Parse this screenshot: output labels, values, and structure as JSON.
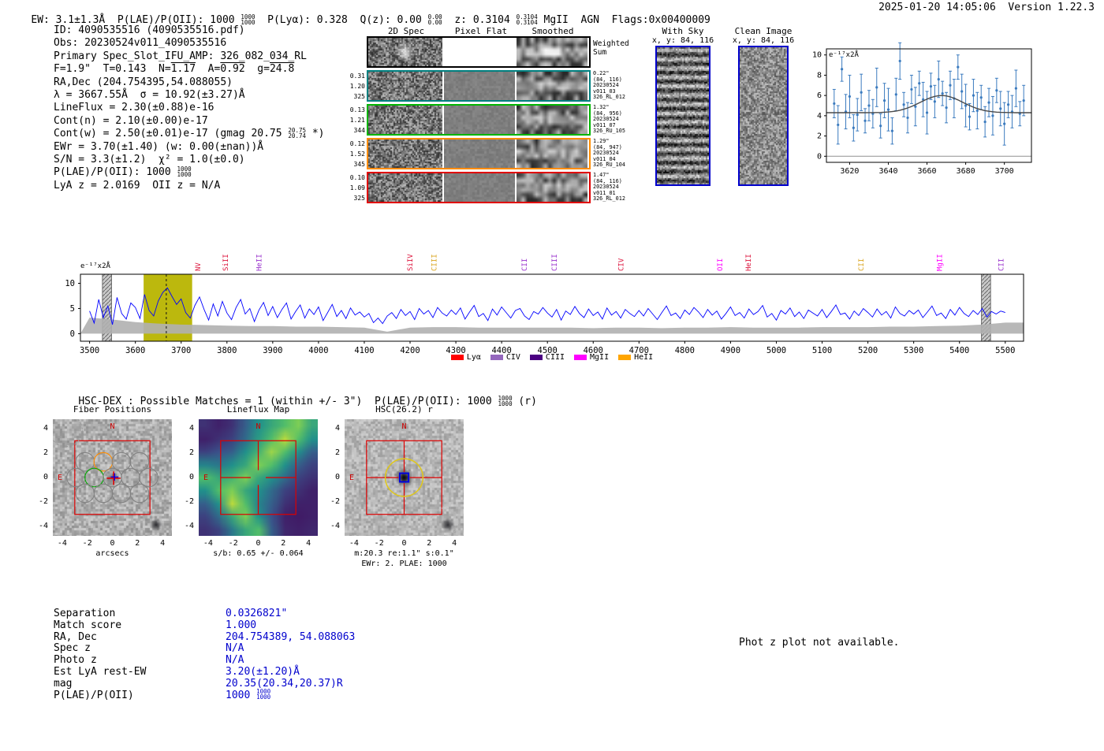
{
  "header": {
    "p1": "EW: 3.1±1.3Å  P(LAE)/P(OII): 1000 ",
    "f1": {
      "top": "1000",
      "bottom": "1000"
    },
    "p2": "  P(Lyα): 0.328  Q(z): 0.00 ",
    "f2": {
      "top": "0.00",
      "bottom": "0.00"
    },
    "p3": "  z: 0.3104 ",
    "f3": {
      "top": "0.3104",
      "bottom": "0.3104"
    },
    "p4": " MgII  AGN  Flags:0x00400009"
  },
  "meta": {
    "text": "2025-01-20 14:05:06  Version 1.22.3"
  },
  "info": {
    "id": "ID: 4090535516 (4090535516.pdf)",
    "obs": "Obs: 20230524v011_4090535516",
    "slot": "Primary Spec_Slot_IFU_AMP: 326_082_034_RL",
    "seeing_pre": "F=1.9\"  T=0.143  N=",
    "seeing_n": "1.17",
    "seeing_mid1": "  A=",
    "seeing_a": "0.92",
    "seeing_mid2": "  g=",
    "seeing_g": "24.8",
    "radec": "RA,Dec (204.754395,54.088055)",
    "lambda": "λ = 3667.55Å  σ = 10.92(±3.27)Å",
    "lineflux": "LineFlux = 2.30(±0.88)e-16",
    "contn": "Cont(n) = 2.10(±0.00)e-17",
    "contw_pre": "Cont(w) = 2.50(±0.01)e-17 (gmag 20.75 ",
    "contw_frac": {
      "top": "20.75",
      "bottom": "20.74"
    },
    "contw_post": " *)",
    "ewr": "EWr = 3.70(±1.40) (w: 0.00(±nan))Å",
    "sn": "S/N = 3.3(±1.2)  χ² = 1.0(±0.0)",
    "plae_pre": "P(LAE)/P(OII): 1000 ",
    "plae_frac": {
      "top": "1000",
      "bottom": "1000"
    },
    "lyaz": "LyA z = 2.0169  OII z = N/A"
  },
  "spec2d": {
    "headers": [
      "2D Spec",
      "Pixel Flat",
      "Smoothed"
    ],
    "withsky": {
      "title": "With Sky",
      "coords": "x, y: 84, 116"
    },
    "clean": {
      "title": "Clean Image",
      "coords": "x, y: 84, 116"
    },
    "rows": [
      {
        "frame": "#000000",
        "weighted": true,
        "left": [],
        "right": [
          "Weighted",
          "Sum"
        ]
      },
      {
        "frame": "#008080",
        "weighted": false,
        "left": [
          "0.31",
          "1.20",
          "325"
        ],
        "right": [
          "0.22\"",
          "(84, 116)",
          "20230524",
          "v011_03",
          "326_RL_012"
        ]
      },
      {
        "frame": "#00b400",
        "weighted": false,
        "left": [
          "0.13",
          "1.21",
          "344"
        ],
        "right": [
          "1.32\"",
          "(84, 956)",
          "20230524",
          "v011_07",
          "326_RU_105"
        ]
      },
      {
        "frame": "#ff8c00",
        "weighted": false,
        "left": [
          "0.12",
          "1.52",
          "345"
        ],
        "right": [
          "1.29\"",
          "(84, 947)",
          "20230524",
          "v011_04",
          "326_RU_104"
        ]
      },
      {
        "frame": "#e00000",
        "weighted": false,
        "left": [
          "0.10",
          "1.09",
          "325"
        ],
        "right": [
          "1.47\"",
          "(84, 116)",
          "20230524",
          "v011_01",
          "326_RL_012"
        ]
      }
    ]
  },
  "hscdex": {
    "p1": "HSC-DEX : Possible Matches = 1 (within +/- 3\")  P(LAE)/P(OII): 1000 ",
    "f1": {
      "top": "1000",
      "bottom": "1000"
    },
    "p2": " (r)"
  },
  "cutouts": {
    "ticks": [
      -4,
      -2,
      0,
      2,
      4
    ],
    "fiber": {
      "title": "Fiber Positions",
      "xlabel": "arcsecs",
      "north_label": "N",
      "east_label": "E",
      "circle_radius": 0.74,
      "circles": [
        [
          -2.18,
          1.28
        ],
        [
          -0.73,
          1.28
        ],
        [
          0.72,
          1.28
        ],
        [
          2.17,
          1.28
        ],
        [
          -2.9,
          0
        ],
        [
          -1.45,
          0
        ],
        [
          0,
          0
        ],
        [
          1.45,
          0
        ],
        [
          2.9,
          0
        ],
        [
          -2.18,
          -1.28
        ],
        [
          -0.73,
          -1.28
        ],
        [
          0.72,
          -1.28
        ],
        [
          2.17,
          -1.28
        ]
      ],
      "green_circle": [
        -1.45,
        0
      ],
      "orange_circle": [
        -0.73,
        1.28
      ],
      "square": [
        -3,
        3
      ],
      "red_cross": [
        0.1,
        -0.05
      ],
      "blue_cross": [
        0.18,
        0.05
      ],
      "dashed_circle": [
        -3.7,
        3.85,
        1.3
      ]
    },
    "lineflux": {
      "title": "Lineflux Map",
      "xlabel": "s/b: 0.65 +/- 0.064",
      "north_label": "N",
      "east_label": "E",
      "square": [
        -3,
        3
      ]
    },
    "hsc": {
      "title": "HSC(26.2) r",
      "xlabel": "m:20.3 re:1.1\" s:0.1\"",
      "xlabel2": "EWr: 2. PLAE: 1000",
      "north_label": "N",
      "east_label": "E",
      "square": [
        -3,
        3
      ],
      "aperture_radius": 1.5,
      "blue_square_size": 0.7,
      "dashed_circles": [
        [
          -3.3,
          4.2,
          1.0
        ],
        [
          3.25,
          -3.6,
          1.1
        ]
      ]
    }
  },
  "match_table": {
    "rows": [
      {
        "label": "Separation",
        "value": "0.0326821\""
      },
      {
        "label": "Match score",
        "value": "1.000"
      },
      {
        "label": "RA, Dec",
        "value": "204.754389, 54.088063"
      },
      {
        "label": "Spec z",
        "value": "N/A"
      },
      {
        "label": "Photo z",
        "value": "N/A"
      },
      {
        "label": "Est LyA rest-EW",
        "value": "3.20(±1.20)Å"
      },
      {
        "label": "mag",
        "value": "20.35(20.34,20.37)R"
      },
      {
        "label": "P(LAE)/P(OII)",
        "value": "1000",
        "frac": {
          "top": "1000",
          "bottom": "1000"
        }
      }
    ]
  },
  "photz_note": "Phot z plot not available.",
  "chart_data": [
    {
      "id": "line_fit_inset",
      "type": "scatter",
      "corner_label": "e⁻¹⁷x2Å",
      "x_start": 3612,
      "x_step": 2,
      "y": [
        5.2,
        3.1,
        8.6,
        4.4,
        5.9,
        2.8,
        4.1,
        6.3,
        3.5,
        5.0,
        4.2,
        6.8,
        3.0,
        5.5,
        4.6,
        2.5,
        6.1,
        9.4,
        5.1,
        3.8,
        6.6,
        4.9,
        7.2,
        5.6,
        4.3,
        6.9,
        5.4,
        7.6,
        6.2,
        4.8,
        7.0,
        5.7,
        8.8,
        6.4,
        5.0,
        3.9,
        6.0,
        4.5,
        5.8,
        3.4,
        5.3,
        4.0,
        6.5,
        4.7,
        3.2,
        5.1,
        4.4,
        6.7,
        4.2,
        5.5
      ],
      "yerr": [
        1.4,
        1.9,
        1.2,
        1.7,
        2.1,
        1.3,
        1.6,
        1.8,
        1.2,
        1.5,
        1.4,
        1.9,
        1.2,
        1.7,
        2.1,
        1.3,
        1.6,
        1.8,
        1.2,
        1.5,
        1.4,
        1.9,
        1.2,
        1.7,
        2.1,
        1.3,
        1.6,
        1.8,
        1.2,
        1.5,
        1.4,
        1.9,
        1.2,
        1.7,
        2.1,
        1.3,
        1.6,
        1.8,
        1.2,
        1.5,
        1.4,
        1.9,
        1.2,
        1.7,
        2.1,
        1.3,
        1.6,
        1.8,
        1.2,
        1.5
      ],
      "fit": {
        "center": 3667.55,
        "sigma": 10.92,
        "continuum": 4.3,
        "amplitude": 1.7
      },
      "xticks": [
        3620,
        3640,
        3660,
        3680,
        3700
      ],
      "yticks": [
        0,
        2,
        4,
        6,
        8,
        10
      ],
      "xlim": [
        3608,
        3714
      ],
      "ylim": [
        -0.6,
        10.6
      ],
      "point_color": "#3b7bbf",
      "fit_color": "#4a4a4a"
    },
    {
      "id": "full_spectrum",
      "type": "line",
      "corner_label": "e⁻¹⁷x2Å",
      "x_start": 3500,
      "x_step": 10,
      "flux": [
        4.5,
        2.1,
        6.8,
        3.2,
        5.5,
        1.8,
        7.2,
        4.0,
        2.9,
        6.1,
        5.2,
        3.0,
        7.8,
        4.6,
        3.5,
        6.5,
        8.2,
        9.1,
        7.4,
        5.8,
        6.9,
        4.2,
        3.1,
        5.6,
        7.3,
        4.8,
        2.7,
        5.9,
        3.5,
        6.4,
        4.1,
        2.8,
        5.2,
        6.8,
        3.9,
        5.0,
        2.4,
        4.7,
        6.2,
        3.6,
        5.4,
        3.2,
        4.8,
        6.1,
        2.9,
        4.4,
        5.7,
        3.1,
        4.9,
        3.8,
        5.3,
        2.6,
        4.2,
        5.8,
        3.4,
        4.6,
        3.0,
        5.1,
        3.7,
        4.3,
        3.3,
        4.0,
        2.2,
        3.1,
        2.0,
        3.5,
        4.2,
        3.0,
        4.8,
        3.6,
        4.4,
        2.8,
        5.0,
        3.9,
        4.6,
        3.2,
        5.2,
        4.1,
        3.5,
        4.7,
        3.8,
        5.1,
        2.9,
        4.3,
        5.6,
        3.4,
        4.0,
        2.6,
        4.9,
        3.7,
        5.3,
        4.2,
        3.1,
        4.6,
        5.0,
        3.5,
        2.8,
        4.4,
        3.9,
        5.2,
        4.1,
        3.3,
        4.8,
        2.7,
        4.5,
        3.8,
        5.4,
        4.0,
        3.2,
        4.9,
        3.6,
        4.3,
        2.9,
        5.1,
        3.7,
        4.4,
        3.1,
        4.8,
        4.0,
        3.4,
        4.6,
        3.5,
        5.0,
        3.9,
        2.8,
        4.2,
        5.5,
        3.6,
        4.1,
        3.0,
        4.7,
        3.8,
        5.2,
        4.3,
        3.2,
        4.8,
        3.7,
        4.5,
        2.9,
        4.0,
        5.3,
        3.6,
        4.2,
        3.1,
        4.9,
        3.8,
        4.4,
        5.6,
        3.3,
        4.0,
        2.7,
        4.6,
        3.9,
        5.1,
        3.4,
        4.3,
        3.0,
        4.7,
        4.1,
        3.5,
        4.8,
        3.2,
        4.4,
        5.7,
        3.8,
        4.1,
        2.9,
        4.5,
        3.6,
        5.0,
        4.2,
        3.3,
        4.9,
        3.7,
        4.4,
        3.1,
        5.3,
        4.0,
        3.5,
        4.6,
        3.9,
        4.7,
        3.2,
        4.3,
        5.5,
        3.6,
        4.1,
        3.0,
        4.8,
        3.7,
        5.2,
        4.0,
        3.4,
        4.6,
        3.8,
        5.0,
        3.3,
        4.4,
        3.9,
        4.5,
        4.2
      ],
      "noise_x_step": 50,
      "noise": [
        3.2,
        2.8,
        2.3,
        2.0,
        1.8,
        1.7,
        1.6,
        1.5,
        1.5,
        1.4,
        1.4,
        1.3,
        1.2,
        0.4,
        1.2,
        1.3,
        1.3,
        1.2,
        1.2,
        1.2,
        1.2,
        1.2,
        1.1,
        1.2,
        1.2,
        1.1,
        1.2,
        1.2,
        1.3,
        1.2,
        1.2,
        1.2,
        1.3,
        1.3,
        1.3,
        1.4,
        1.4,
        1.5,
        1.6,
        1.8,
        2.2
      ],
      "xticks": [
        3500,
        3600,
        3700,
        3800,
        3900,
        4000,
        4100,
        4200,
        4300,
        4400,
        4500,
        4600,
        4700,
        4800,
        4900,
        5000,
        5100,
        5200,
        5300,
        5400,
        5500
      ],
      "yticks": [
        0,
        5,
        10
      ],
      "xlim": [
        3480,
        5540
      ],
      "ylim": [
        -1.5,
        11.8
      ],
      "line_color": "#0000ff",
      "noise_color": "#b0b0b0",
      "highlight_band": {
        "x0": 3618,
        "x1": 3724,
        "color": "#b8b400"
      },
      "sky_bands": [
        {
          "x0": 3528,
          "x1": 3548
        },
        {
          "x0": 5448,
          "x1": 5468
        }
      ],
      "detect_line": 3667.55,
      "ion_labels": [
        {
          "name": "NV",
          "wave": 3742,
          "color": "#dc143c"
        },
        {
          "name": "SiII",
          "wave": 3802,
          "color": "#dc143c"
        },
        {
          "name": "HeII",
          "wave": 3875,
          "color": "#9932cc"
        },
        {
          "name": "SiIV",
          "wave": 4205,
          "color": "#dc143c"
        },
        {
          "name": "CIII",
          "wave": 4258,
          "color": "#daa520"
        },
        {
          "name": "CII",
          "wave": 4455,
          "color": "#9932cc"
        },
        {
          "name": "CIII",
          "wave": 4520,
          "color": "#9932cc"
        },
        {
          "name": "CIV",
          "wave": 4666,
          "color": "#dc143c"
        },
        {
          "name": "OII",
          "wave": 4882,
          "color": "#ff00ff"
        },
        {
          "name": "HeII",
          "wave": 4944,
          "color": "#dc143c"
        },
        {
          "name": "CII",
          "wave": 5190,
          "color": "#daa520"
        },
        {
          "name": "MgII",
          "wave": 5362,
          "color": "#ff00ff"
        },
        {
          "name": "CII",
          "wave": 5496,
          "color": "#9932cc"
        }
      ],
      "legend": [
        {
          "label": "Lyα",
          "color": "#ff0000"
        },
        {
          "label": "CIV",
          "color": "#9467bd"
        },
        {
          "label": "CIII",
          "color": "#4b0082"
        },
        {
          "label": "MgII",
          "color": "#ff00ff"
        },
        {
          "label": "HeII",
          "color": "#ffa500"
        }
      ]
    },
    {
      "id": "lineflux_map",
      "type": "heatmap",
      "extent": [
        -4.75,
        4.75,
        -4.75,
        4.75
      ],
      "grid": [
        [
          0.15,
          0.1,
          0.15,
          0.3,
          0.5,
          0.6,
          0.7,
          0.8,
          0.6
        ],
        [
          0.1,
          0.15,
          0.2,
          0.35,
          0.55,
          0.7,
          0.9,
          0.7,
          0.5
        ],
        [
          0.2,
          0.25,
          0.3,
          0.5,
          0.65,
          0.85,
          0.7,
          0.5,
          0.3
        ],
        [
          0.45,
          0.4,
          0.5,
          0.6,
          0.8,
          0.7,
          0.5,
          0.3,
          0.2
        ],
        [
          0.7,
          0.6,
          0.65,
          0.8,
          0.6,
          0.5,
          0.35,
          0.2,
          0.15
        ],
        [
          0.5,
          0.7,
          0.8,
          0.6,
          0.5,
          0.35,
          0.2,
          0.15,
          0.1
        ],
        [
          0.3,
          0.5,
          0.9,
          0.7,
          0.45,
          0.3,
          0.15,
          0.1,
          0.1
        ],
        [
          0.2,
          0.35,
          0.6,
          0.8,
          0.5,
          0.25,
          0.1,
          0.08,
          0.1
        ],
        [
          0.15,
          0.2,
          0.4,
          0.6,
          0.7,
          0.3,
          0.12,
          0.1,
          0.12
        ]
      ]
    }
  ]
}
